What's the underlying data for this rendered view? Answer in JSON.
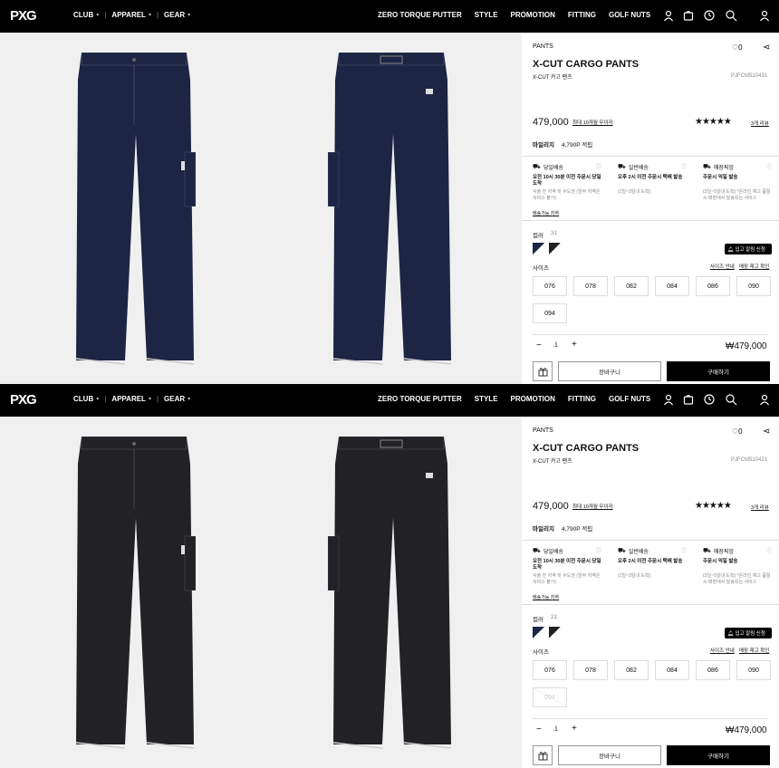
{
  "nav": {
    "logo": "PXG",
    "left": [
      "CLUB",
      "APPAREL",
      "GEAR"
    ],
    "sep": "|",
    "right": [
      "ZERO TORQUE PUTTER",
      "STYLE",
      "PROMOTION",
      "FITTING",
      "GOLF NUTS"
    ],
    "icons": [
      "user-icon",
      "bag-icon",
      "history-icon",
      "search-icon",
      "account-icon"
    ]
  },
  "panels": [
    {
      "category": "PANTS",
      "wish": "♡0",
      "title": "X-CUT CARGO PANTS",
      "subtitle": "X-CUT 카고 팬츠",
      "code": "PJFCM510431",
      "price": "479,000",
      "installment": "최대 10개월 무이자",
      "stars": "★★★★★",
      "reviews": "3개 리뷰",
      "mileage_label": "마일리지",
      "mileage_value": "4,790P 적립",
      "delivery": [
        {
          "title": "당일배송",
          "bold": "오전 10시 30분 이전 주문시 당일도착",
          "note": "서울 전 지역 및 수도권 (일부 지역은 서비스 불가)",
          "link": "배송가능 지역"
        },
        {
          "title": "일반배송",
          "bold": "오후 2시 이전 주문시 택배 발송",
          "note": "(2일~3일내 도착)",
          "link": ""
        },
        {
          "title": "매장픽업",
          "bold": "주문시 익일 발송",
          "note": "(3일~5일내 도착) *온라인 재고 품절시 매장에서 발송되는 서비스",
          "link": ""
        }
      ],
      "color_label": "컬러",
      "color_value": "31",
      "alarm": "입고 알림 신청",
      "size_label": "사이즈",
      "size_guide": "사이즈 안내",
      "stock_check": "매장 재고 확인",
      "sizes": [
        {
          "v": "076",
          "dis": false
        },
        {
          "v": "078",
          "dis": false
        },
        {
          "v": "082",
          "dis": false
        },
        {
          "v": "084",
          "dis": false
        },
        {
          "v": "086",
          "dis": false
        },
        {
          "v": "090",
          "dis": false
        },
        {
          "v": "094",
          "dis": false
        }
      ],
      "qty": "1",
      "total": "₩479,000",
      "cart": "장바구니",
      "buy": "구매하기",
      "pant_color": "#1d2544"
    },
    {
      "category": "PANTS",
      "wish": "♡0",
      "title": "X-CUT CARGO PANTS",
      "subtitle": "X-CUT 카고 팬츠",
      "code": "PJFCM510421",
      "price": "479,000",
      "installment": "최대 10개월 무이자",
      "stars": "★★★★★",
      "reviews": "3개 리뷰",
      "mileage_label": "마일리지",
      "mileage_value": "4,790P 적립",
      "delivery": [
        {
          "title": "당일배송",
          "bold": "오전 10시 30분 이전 주문시 당일도착",
          "note": "서울 전 지역 및 수도권 (일부 지역은 서비스 불가)",
          "link": "배송가능 지역"
        },
        {
          "title": "일반배송",
          "bold": "오후 2시 이전 주문시 택배 발송",
          "note": "(2일~3일내 도착)",
          "link": ""
        },
        {
          "title": "매장픽업",
          "bold": "주문시 익일 발송",
          "note": "(3일~5일내 도착) *온라인 재고 품절시 매장에서 발송되는 서비스",
          "link": ""
        }
      ],
      "color_label": "컬러",
      "color_value": "21",
      "alarm": "입고 알림 신청",
      "size_label": "사이즈",
      "size_guide": "사이즈 안내",
      "stock_check": "매장 재고 확인",
      "sizes": [
        {
          "v": "076",
          "dis": false
        },
        {
          "v": "078",
          "dis": false
        },
        {
          "v": "082",
          "dis": false
        },
        {
          "v": "084",
          "dis": false
        },
        {
          "v": "086",
          "dis": false
        },
        {
          "v": "090",
          "dis": false
        },
        {
          "v": "094",
          "dis": true
        }
      ],
      "qty": "1",
      "total": "₩479,000",
      "cart": "장바구니",
      "buy": "구매하기",
      "pant_color": "#222226"
    }
  ],
  "swatches": [
    "#1d2544",
    "#222226"
  ]
}
